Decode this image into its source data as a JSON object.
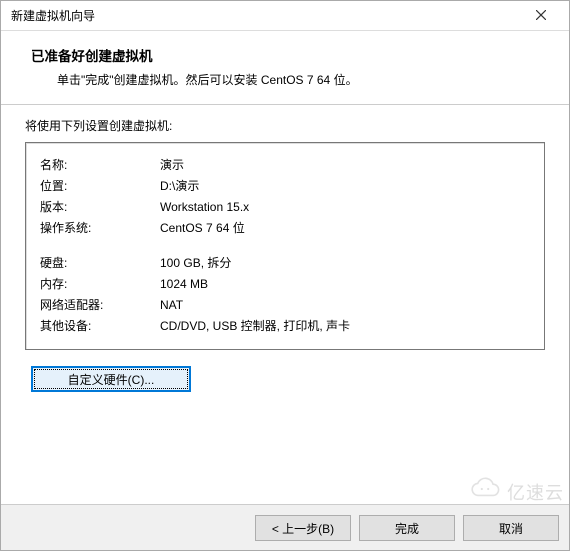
{
  "window": {
    "title": "新建虚拟机向导"
  },
  "header": {
    "heading": "已准备好创建虚拟机",
    "subtext": "单击\"完成\"创建虚拟机。然后可以安装 CentOS 7 64 位。"
  },
  "intro": "将使用下列设置创建虚拟机:",
  "settings": {
    "group1": [
      {
        "label": "名称:",
        "value": "演示"
      },
      {
        "label": "位置:",
        "value": "D:\\演示"
      },
      {
        "label": "版本:",
        "value": "Workstation 15.x"
      },
      {
        "label": "操作系统:",
        "value": "CentOS 7 64 位"
      }
    ],
    "group2": [
      {
        "label": "硬盘:",
        "value": "100 GB, 拆分"
      },
      {
        "label": "内存:",
        "value": "1024 MB"
      },
      {
        "label": "网络适配器:",
        "value": "NAT"
      },
      {
        "label": "其他设备:",
        "value": "CD/DVD, USB 控制器, 打印机, 声卡"
      }
    ]
  },
  "buttons": {
    "customize": "自定义硬件(C)...",
    "back": "< 上一步(B)",
    "finish": "完成",
    "cancel": "取消"
  },
  "watermark": {
    "text": "亿速云"
  }
}
